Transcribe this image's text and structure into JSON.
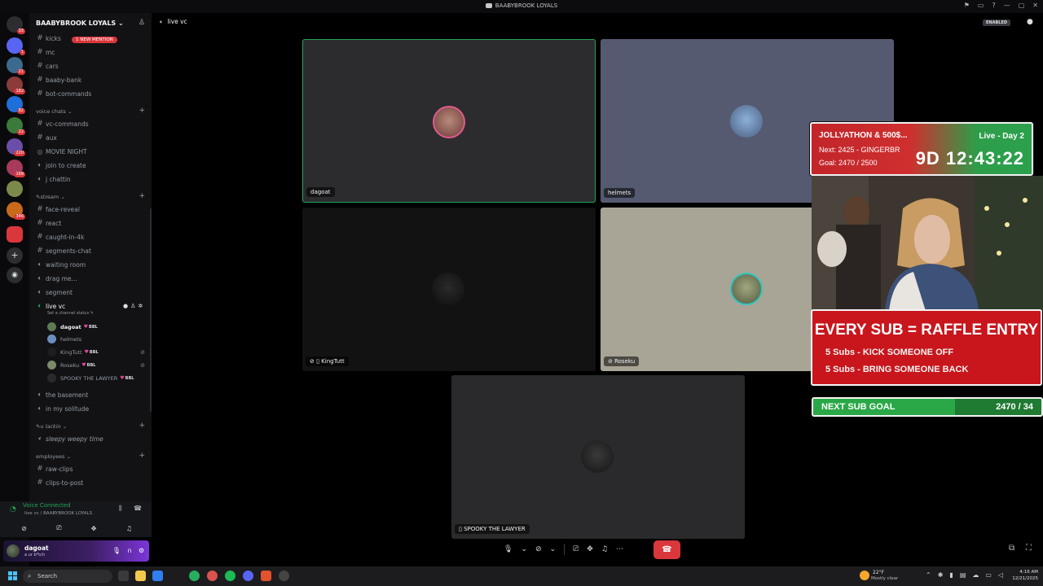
{
  "window": {
    "title": "BAABYBROOK LOYALS"
  },
  "server": {
    "name": "BAABYBROOK LOYALS"
  },
  "guild_badges": [
    "33",
    "1",
    "21",
    "182",
    "82",
    "22",
    "220",
    "168",
    "346"
  ],
  "channels_top": [
    {
      "name": "kicks",
      "mention": "1 NEW MENTION"
    },
    {
      "name": "mc"
    },
    {
      "name": "cars"
    },
    {
      "name": "baaby-bank"
    },
    {
      "name": "bot-commands"
    }
  ],
  "cat_voice": "voice chats",
  "channels_voice": [
    "vc-commands",
    "aux",
    "MOVIE NIGHT",
    "join to create",
    "j chattin"
  ],
  "cat_stream": "stream",
  "channels_stream": [
    "face-reveal",
    "react",
    "caught-in-4k",
    "segments-chat",
    "waiting room",
    "drag me...",
    "segment"
  ],
  "active_channel": {
    "name": "live vc",
    "status": "Set a channel status"
  },
  "voice_users": [
    {
      "name": "dagoat",
      "tag": "BBL"
    },
    {
      "name": "helmets"
    },
    {
      "name": "KingTutt",
      "tag": "BBL"
    },
    {
      "name": "Roseku",
      "tag": "BBL"
    },
    {
      "name": "SPOOKY THE LAWYER",
      "tag": "BBL"
    }
  ],
  "channels_after": [
    "the basement",
    "in my solitude"
  ],
  "cat_ulackin": "u lackin",
  "channel_sleepy": "sleepy weepy time",
  "cat_employees": "employees",
  "channels_emp": [
    "raw-clips",
    "clips-to-post"
  ],
  "voice_status": {
    "title": "Voice Connected",
    "sub": "live vc / BAABYBROOK LOYALS"
  },
  "user": {
    "name": "dagoat",
    "status": "a ur b*tch"
  },
  "header": {
    "channel": "live vc",
    "enabled": "ENABLED"
  },
  "tiles": [
    {
      "name": "dagoat",
      "speaking": true
    },
    {
      "name": "helmets",
      "speaking": false
    },
    {
      "name": "KingTutt",
      "speaking": false
    },
    {
      "name": "Roseku",
      "speaking": false
    },
    {
      "name": "SPOOKY THE LAWYER",
      "speaking": false
    }
  ],
  "overlay": {
    "line1": "JOLLYATHON & 500$...",
    "live": "Live - Day 2",
    "next": "Next: 2425 - GINGERBR",
    "goal": "Goal: 2470 / 2500",
    "timer": "9D 12:43:22",
    "raffle_title": "EVERY SUB = RAFFLE ENTRY",
    "raffle_1": "5 Subs - KICK SOMEONE OFF",
    "raffle_2": "5 Subs - BRING SOMEONE BACK",
    "goal_label": "NEXT SUB GOAL",
    "goal_value": "2470 / 34",
    "goal_progress": 0.62
  },
  "taskbar": {
    "search": "Search",
    "weather_temp": "22°F",
    "weather_desc": "Mostly clear",
    "time": "4:16 AM",
    "date": "12/21/2025"
  },
  "colors": {
    "speaking": "#23a55a",
    "danger": "#da373c",
    "sidebar": "#121214"
  }
}
